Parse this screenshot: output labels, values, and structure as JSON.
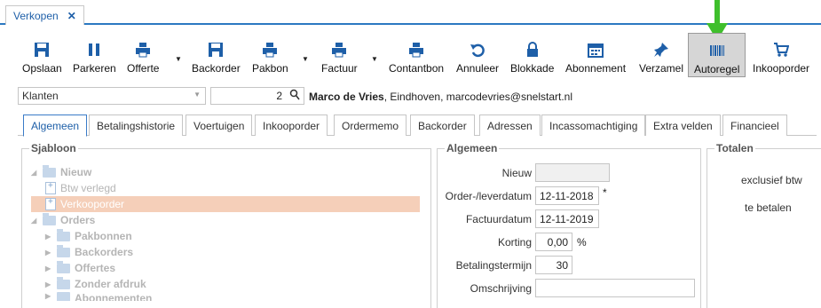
{
  "document_tab": {
    "label": "Verkopen",
    "close": "✕"
  },
  "toolbar": {
    "items": [
      {
        "label": "Opslaan",
        "icon": "save-icon"
      },
      {
        "label": "Parkeren",
        "icon": "pause-icon"
      },
      {
        "label": "Offerte",
        "icon": "print-icon"
      },
      {
        "label": "Backorder",
        "icon": "save-icon"
      },
      {
        "label": "Pakbon",
        "icon": "print-icon"
      },
      {
        "label": "Factuur",
        "icon": "print-icon"
      },
      {
        "label": "Contantbon",
        "icon": "print-icon"
      },
      {
        "label": "Annuleer",
        "icon": "undo-icon"
      },
      {
        "label": "Blokkade",
        "icon": "lock-icon"
      },
      {
        "label": "Abonnement",
        "icon": "calendar-icon"
      },
      {
        "label": "Verzamel",
        "icon": "pin-icon"
      },
      {
        "label": "Autoregel",
        "icon": "barcode-icon"
      },
      {
        "label": "Inkooporder",
        "icon": "cart-icon"
      }
    ]
  },
  "customer_bar": {
    "type_value": "Klanten",
    "number_value": "2",
    "customer_name": "Marco de Vries",
    "customer_details": ", Eindhoven, marcodevries@snelstart.nl"
  },
  "tabs": [
    "Algemeen",
    "Betalingshistorie",
    "Voertuigen",
    "Inkooporder",
    "Ordermemo",
    "Backorder",
    "Adressen",
    "Incassomachtiging",
    "Extra velden",
    "Financieel"
  ],
  "sjabloon": {
    "title": "Sjabloon",
    "tree": [
      {
        "label": "Nieuw",
        "level": 0,
        "bold": true
      },
      {
        "label": "Btw verlegd",
        "level": 1,
        "bold": false
      },
      {
        "label": "Verkooporder",
        "level": 1,
        "bold": false,
        "selected": true
      },
      {
        "label": "Orders",
        "level": 0,
        "bold": true
      },
      {
        "label": "Pakbonnen",
        "level": 1,
        "bold": true
      },
      {
        "label": "Backorders",
        "level": 1,
        "bold": true
      },
      {
        "label": "Offertes",
        "level": 1,
        "bold": true
      },
      {
        "label": "Zonder afdruk",
        "level": 1,
        "bold": true
      },
      {
        "label": "Abonnementen",
        "level": 1,
        "bold": true
      }
    ]
  },
  "algemeen": {
    "title": "Algemeen",
    "nieuw_label": "Nieuw",
    "order_label": "Order-/leverdatum",
    "order_value": "12-11-2018",
    "order_required": "*",
    "factuur_label": "Factuurdatum",
    "factuur_value": "12-11-2019",
    "korting_label": "Korting",
    "korting_value": "0,00",
    "korting_suffix": "%",
    "termijn_label": "Betalingstermijn",
    "termijn_value": "30",
    "omschrijving_label": "Omschrijving",
    "omschrijving_value": ""
  },
  "totalen": {
    "title": "Totalen",
    "excl_btw": "exclusief btw",
    "te_betalen": "te betalen"
  },
  "colors": {
    "accent": "#2b79c2",
    "icon_blue": "#1e5fa8",
    "arrow_green": "#3fbf2c",
    "selected_row": "#f5cfb9"
  }
}
